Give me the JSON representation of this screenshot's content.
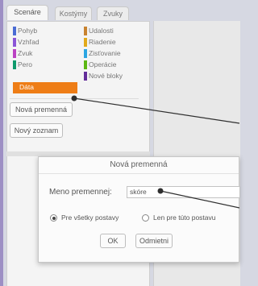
{
  "tabs": [
    {
      "label": "Scenáre",
      "active": true
    },
    {
      "label": "Kostýmy",
      "active": false
    },
    {
      "label": "Zvuky",
      "active": false
    }
  ],
  "categories_left": [
    {
      "label": "Pohyb",
      "color": "#4a6cd4"
    },
    {
      "label": "Vzhľad",
      "color": "#8a55d7"
    },
    {
      "label": "Zvuk",
      "color": "#bb42c3"
    },
    {
      "label": "Pero",
      "color": "#0e9a6c"
    },
    {
      "label": "Dáta",
      "color": "#ee7d16",
      "active": true
    }
  ],
  "categories_right": [
    {
      "label": "Udalosti",
      "color": "#c88330"
    },
    {
      "label": "Riadenie",
      "color": "#e1a91a"
    },
    {
      "label": "Zisťovanie",
      "color": "#2ca5e2"
    },
    {
      "label": "Operácie",
      "color": "#5cb712"
    },
    {
      "label": "Nové bloky",
      "color": "#632d99"
    }
  ],
  "buttons": {
    "new_variable": "Nová premenná",
    "new_list": "Nový zoznam"
  },
  "dialog": {
    "title": "Nová premenná",
    "name_label": "Meno premennej:",
    "name_value": "skóre",
    "radio_all": "Pre všetky postavy",
    "radio_sprite": "Len pre túto postavu",
    "ok": "OK",
    "cancel": "Odmietni"
  },
  "colors": {
    "accent": "#ee7d16",
    "sidebar": "#9d8fc4"
  }
}
